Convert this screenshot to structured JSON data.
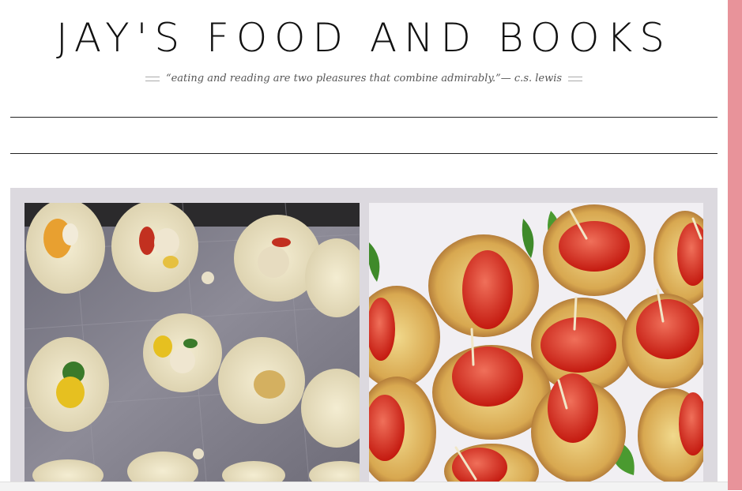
{
  "site": {
    "title": "JAY'S FOOD AND BOOKS",
    "tagline": "“eating and reading are two pleasures that combine admirably.”— c.s. lewis"
  },
  "gallery": {
    "photos": [
      {
        "description_icon": "food-photo-icon"
      },
      {
        "description_icon": "food-photo-icon"
      }
    ]
  },
  "colors": {
    "accent_right_edge": "#e8939a",
    "gallery_background": "#dcd9df"
  }
}
